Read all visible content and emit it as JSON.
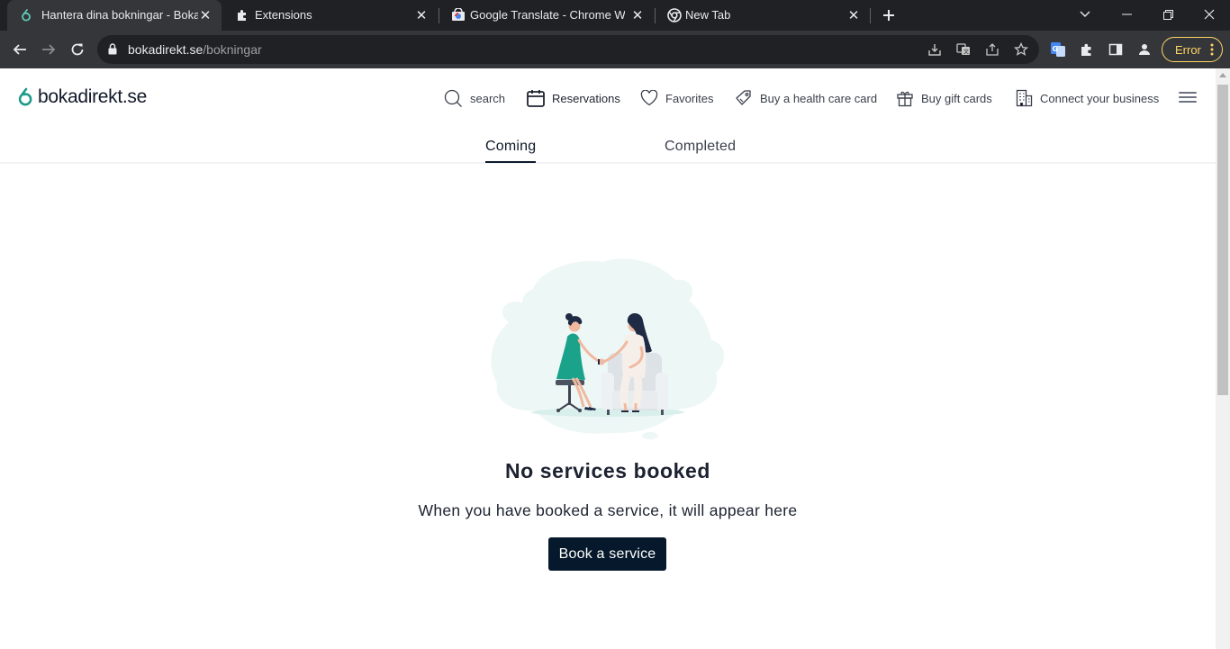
{
  "browser": {
    "tabs": [
      {
        "title": "Hantera dina bokningar - Bokadirekt",
        "icon": "bokadirekt-favicon",
        "active": true
      },
      {
        "title": "Extensions",
        "icon": "puzzle-icon",
        "active": false
      },
      {
        "title": "Google Translate - Chrome Web Store",
        "icon": "web-store-icon",
        "active": false
      },
      {
        "title": "New Tab",
        "icon": "chrome-icon",
        "active": false
      }
    ],
    "url_host": "bokadirekt.se",
    "url_path": "/bokningar",
    "profile_error_label": "Error",
    "colors": {
      "frame": "#202124",
      "toolbar": "#35363a",
      "error_accent": "#fdd663"
    }
  },
  "site": {
    "logo_text": "bokadirekt.se",
    "brand_color": "#1d9a8a",
    "nav": [
      {
        "label": "search",
        "icon": "search-icon"
      },
      {
        "label": "Reservations",
        "icon": "calendar-icon"
      },
      {
        "label": "Favorites",
        "icon": "heart-icon"
      },
      {
        "label": "Buy a health care card",
        "icon": "tag-icon"
      },
      {
        "label": "Buy gift cards",
        "icon": "gift-icon"
      },
      {
        "label": "Connect your business",
        "icon": "building-icon"
      }
    ],
    "tabs": [
      {
        "label": "Coming",
        "active": true
      },
      {
        "label": "Completed",
        "active": false
      }
    ],
    "empty_state": {
      "title": "No services booked",
      "subtitle": "When you have booked a service, it will appear here",
      "button_label": "Book a service"
    }
  }
}
